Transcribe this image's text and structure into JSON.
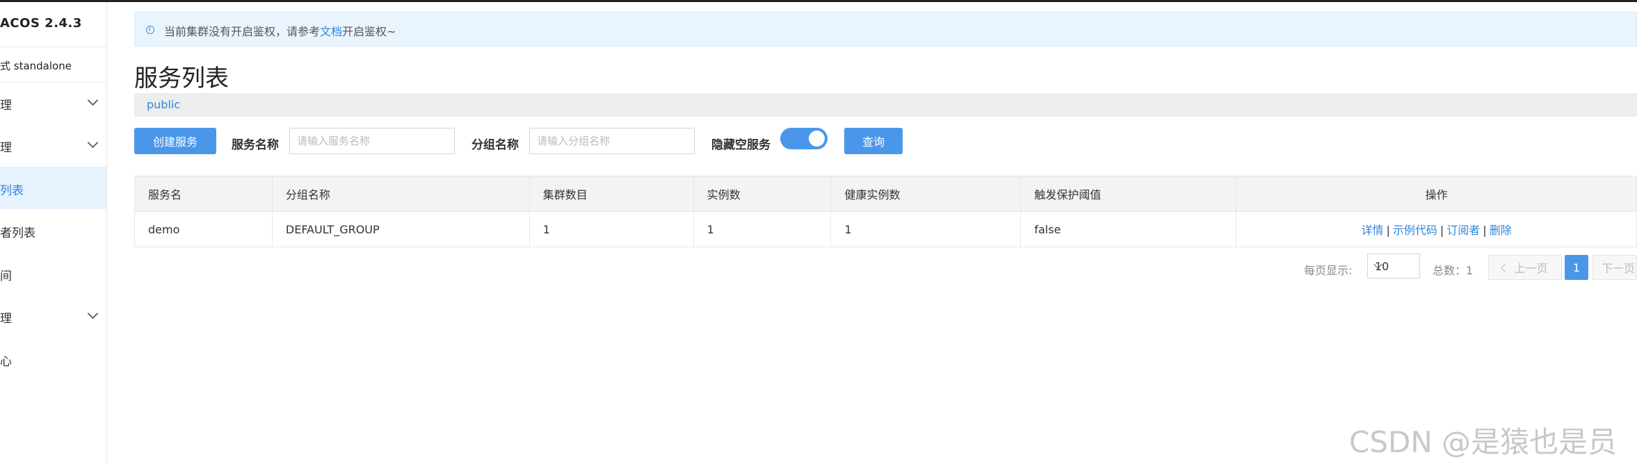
{
  "sidebar": {
    "brand": "ACOS 2.4.3",
    "mode": "式 standalone",
    "items": [
      {
        "label": "理",
        "expandable": true
      },
      {
        "label": "理",
        "expandable": true
      },
      {
        "label": "列表",
        "expandable": false,
        "active": true
      },
      {
        "label": "者列表",
        "expandable": false
      },
      {
        "label": "间",
        "expandable": false
      },
      {
        "label": "理",
        "expandable": true
      },
      {
        "label": "心",
        "expandable": false
      }
    ]
  },
  "alert": {
    "text_before": "当前集群没有开启鉴权，请参考",
    "link": "文档",
    "text_after": "开启鉴权~",
    "icon": "info-icon"
  },
  "page": {
    "title": "服务列表",
    "namespace": "public"
  },
  "toolbar": {
    "create_button": "创建服务",
    "service_name_label": "服务名称",
    "service_name_placeholder": "请输入服务名称",
    "group_name_label": "分组名称",
    "group_name_placeholder": "请输入分组名称",
    "hide_empty_label": "隐藏空服务",
    "hide_empty_on": true,
    "query_button": "查询"
  },
  "table": {
    "headers": [
      "服务名",
      "分组名称",
      "集群数目",
      "实例数",
      "健康实例数",
      "触发保护阈值",
      "操作"
    ],
    "rows": [
      {
        "cells": [
          "demo",
          "DEFAULT_GROUP",
          "1",
          "1",
          "1",
          "false"
        ],
        "actions": [
          "详情",
          "示例代码",
          "订阅者",
          "删除"
        ],
        "separator": "|"
      }
    ]
  },
  "pagination": {
    "page_size_label": "每页显示:",
    "page_size": "10",
    "total_label": "总数：1",
    "prev_label": "上一页",
    "current_page": "1",
    "next_label": "下一页"
  },
  "watermark": "CSDN @是猿也是员"
}
